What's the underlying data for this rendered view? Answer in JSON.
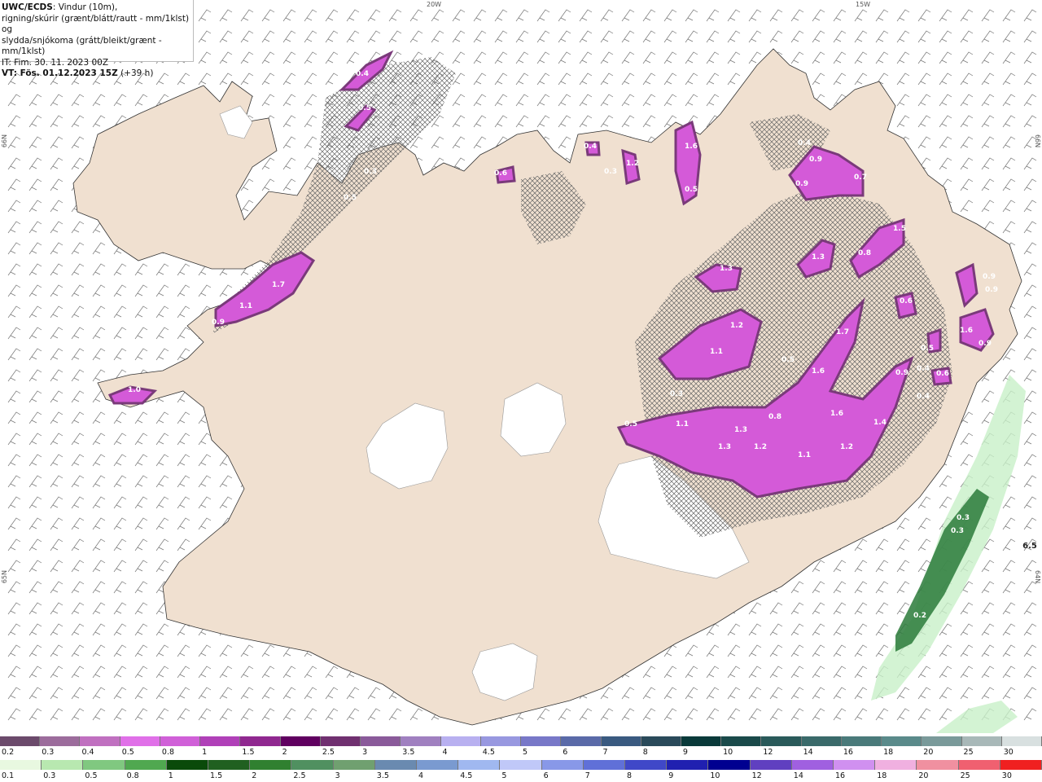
{
  "header": {
    "line1_bold": "UWC/ECDS",
    "line1_rest": ": Vindur (10m),",
    "line2": "rigning/skúrir (grænt/blátt/rautt - mm/1klst) og",
    "line3": "slydda/snjókoma (grátt/bleikt/grænt - mm/1klst)",
    "line4": "IT: Fim. 30. 11. 2023 00Z",
    "line5_bold": "VT: Fös. 01.12.2023 15Z",
    "line5_rest": " (+39 h)"
  },
  "grid_labels": {
    "top_left": "20W",
    "top_right": "15W",
    "left_upper": "66N",
    "right_upper": "66N",
    "left_lower": "65N",
    "right_lower": "64N"
  },
  "map_labels": [
    {
      "text": "0.4"
    },
    {
      "text": "0.5"
    },
    {
      "text": "0.3"
    },
    {
      "text": "1.7"
    },
    {
      "text": "1.1"
    },
    {
      "text": "0.9"
    },
    {
      "text": "1.0"
    },
    {
      "text": "0.5"
    },
    {
      "text": "0.6"
    },
    {
      "text": "0.4"
    },
    {
      "text": "0.3"
    },
    {
      "text": "1.2"
    },
    {
      "text": "1.6"
    },
    {
      "text": "0.5"
    },
    {
      "text": "0.4"
    },
    {
      "text": "0.9"
    },
    {
      "text": "0.7"
    },
    {
      "text": "0.9"
    },
    {
      "text": "1.5"
    },
    {
      "text": "1.3"
    },
    {
      "text": "1.3"
    },
    {
      "text": "0.8"
    },
    {
      "text": "0.9"
    },
    {
      "text": "0.9"
    },
    {
      "text": "0.6"
    },
    {
      "text": "1.2"
    },
    {
      "text": "1.1"
    },
    {
      "text": "1.7"
    },
    {
      "text": "0.5"
    },
    {
      "text": "1.6"
    },
    {
      "text": "0.3"
    },
    {
      "text": "0.5"
    },
    {
      "text": "1.1"
    },
    {
      "text": "1.3"
    },
    {
      "text": "1.3"
    },
    {
      "text": "1.2"
    },
    {
      "text": "0.8"
    },
    {
      "text": "1.6"
    },
    {
      "text": "1.4"
    },
    {
      "text": "1.1"
    },
    {
      "text": "1.2"
    },
    {
      "text": "0.9"
    },
    {
      "text": "0.5"
    },
    {
      "text": "0.4"
    },
    {
      "text": "0.6"
    },
    {
      "text": "0.4"
    },
    {
      "text": "1.6"
    },
    {
      "text": "0.9"
    },
    {
      "text": "0.3"
    },
    {
      "text": "0.3"
    },
    {
      "text": "0.2"
    },
    {
      "text": "6.5"
    }
  ],
  "legend_snow": {
    "labels": [
      "0.2",
      "0.3",
      "0.4",
      "0.5",
      "0.8",
      "1",
      "1.5",
      "2",
      "2.5",
      "3",
      "3.5",
      "4",
      "4.5",
      "5",
      "6",
      "7",
      "8",
      "9",
      "10",
      "12",
      "14",
      "16",
      "18",
      "20",
      "25",
      "30"
    ],
    "colors": [
      "#6b4a6b",
      "#9c6c9c",
      "#c070c0",
      "#e070e8",
      "#d060d8",
      "#b040b8",
      "#902890",
      "#600060",
      "#703070",
      "#8a5a9a",
      "#a080c0",
      "#b8b0f0",
      "#9898e0",
      "#7878c8",
      "#5a6aa8",
      "#3a5a80",
      "#2a4a5a",
      "#0a3a3a",
      "#1a4a4a",
      "#2a5a5a",
      "#3a6a6a",
      "#4a7a7a",
      "#5a8a8a",
      "#7a9a9a",
      "#a8b8b8",
      "#d8e0e0"
    ]
  },
  "legend_rain": {
    "labels": [
      "0.1",
      "0.3",
      "0.5",
      "0.8",
      "1",
      "1.5",
      "2",
      "2.5",
      "3",
      "3.5",
      "4",
      "4.5",
      "5",
      "6",
      "7",
      "8",
      "9",
      "10",
      "12",
      "14",
      "16",
      "18",
      "20",
      "25",
      "30"
    ],
    "colors": [
      "#e8f8e0",
      "#b8e8b0",
      "#80c880",
      "#50a850",
      "#0a4a0a",
      "#206020",
      "#308030",
      "#509060",
      "#70a070",
      "#6a8ab0",
      "#7a9ad0",
      "#a0b8f0",
      "#c0c8f8",
      "#8898e8",
      "#6070d8",
      "#4048c8",
      "#2020b0",
      "#000090",
      "#6040c0",
      "#a060e0",
      "#d090f0",
      "#f0b0e0",
      "#f090a0",
      "#f06070",
      "#f02020"
    ]
  }
}
